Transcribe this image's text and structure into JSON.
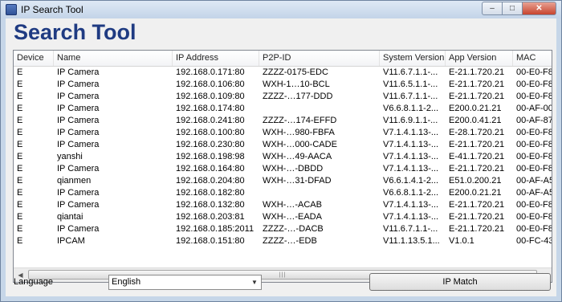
{
  "window": {
    "title": "IP Search Tool",
    "buttons": {
      "minimize": "–",
      "maximize": "□",
      "close": "✕"
    }
  },
  "heading": "Search Tool",
  "table": {
    "columns": [
      "Device",
      "Name",
      "IP Address",
      "P2P-ID",
      "System Version",
      "App Version",
      "MAC"
    ],
    "rows": [
      [
        "E",
        "IP Camera",
        "192.168.0.171:80",
        "ZZZZ-0175-EDC",
        "V11.6.7.1.1-...",
        "E-21.1.720.21",
        "00-E0-F8"
      ],
      [
        "E",
        "IP Camera",
        "192.168.0.106:80",
        "WXH-1…10-BCL",
        "V11.6.5.1.1-...",
        "E-21.1.720.21",
        "00-E0-F8"
      ],
      [
        "E",
        "IP Camera",
        "192.168.0.109:80",
        "ZZZZ-…177-DDD",
        "V11.6.7.1.1-...",
        "E-21.1.720.21",
        "00-E0-F8"
      ],
      [
        "E",
        "IP Camera",
        "192.168.0.174:80",
        "",
        "V6.6.8.1.1-2...",
        "E200.0.21.21",
        "00-AF-00"
      ],
      [
        "E",
        "IP Camera",
        "192.168.0.241:80",
        "ZZZZ-…174-EFFD",
        "V11.6.9.1.1-...",
        "E200.0.41.21",
        "00-AF-87"
      ],
      [
        "E",
        "IP Camera",
        "192.168.0.100:80",
        "WXH-…980-FBFA",
        "V7.1.4.1.13-...",
        "E-28.1.720.21",
        "00-E0-F8"
      ],
      [
        "E",
        "IP Camera",
        "192.168.0.230:80",
        "WXH-…000-CADE",
        "V7.1.4.1.13-...",
        "E-21.1.720.21",
        "00-E0-F8"
      ],
      [
        "E",
        "yanshi",
        "192.168.0.198:98",
        "WXH-…49-AACA",
        "V7.1.4.1.13-...",
        "E-41.1.720.21",
        "00-E0-F8"
      ],
      [
        "E",
        "IP Camera",
        "192.168.0.164:80",
        "WXH-…-DBDD",
        "V7.1.4.1.13-...",
        "E-21.1.720.21",
        "00-E0-F8"
      ],
      [
        "E",
        "qianmen",
        "192.168.0.204:80",
        "WXH-…31-DFAD",
        "V6.6.1.4.1-2...",
        "E51.0.200.21",
        "00-AF-A5"
      ],
      [
        "E",
        "IP Camera",
        "192.168.0.182:80",
        "",
        "V6.6.8.1.1-2...",
        "E200.0.21.21",
        "00-AF-A5"
      ],
      [
        "E",
        "IP Camera",
        "192.168.0.132:80",
        "WXH-…-ACAB",
        "V7.1.4.1.13-...",
        "E-21.1.720.21",
        "00-E0-F8"
      ],
      [
        "E",
        "qiantai",
        "192.168.0.203:81",
        "WXH-…-EADA",
        "V7.1.4.1.13-...",
        "E-21.1.720.21",
        "00-E0-F8"
      ],
      [
        "E",
        "IP Camera",
        "192.168.0.185:2011",
        "ZZZZ-…-DACB",
        "V11.6.7.1.1-...",
        "E-21.1.720.21",
        "00-E0-F8"
      ],
      [
        "E",
        "IPCAM",
        "192.168.0.151:80",
        "ZZZZ-…-EDB",
        "V11.1.13.5.1...",
        "V1.0.1",
        "00-FC-43"
      ]
    ]
  },
  "scroll": {
    "left_icon": "◀",
    "right_icon": "▶",
    "grip": "|||"
  },
  "language": {
    "label": "Language",
    "selected": "English",
    "arrow_icon": "chevron-down-icon",
    "arrow_glyph": "▼"
  },
  "ip_match_button": "IP Match",
  "colors": {
    "heading": "#1f3b82",
    "title_bar": "#c3d4e8"
  }
}
